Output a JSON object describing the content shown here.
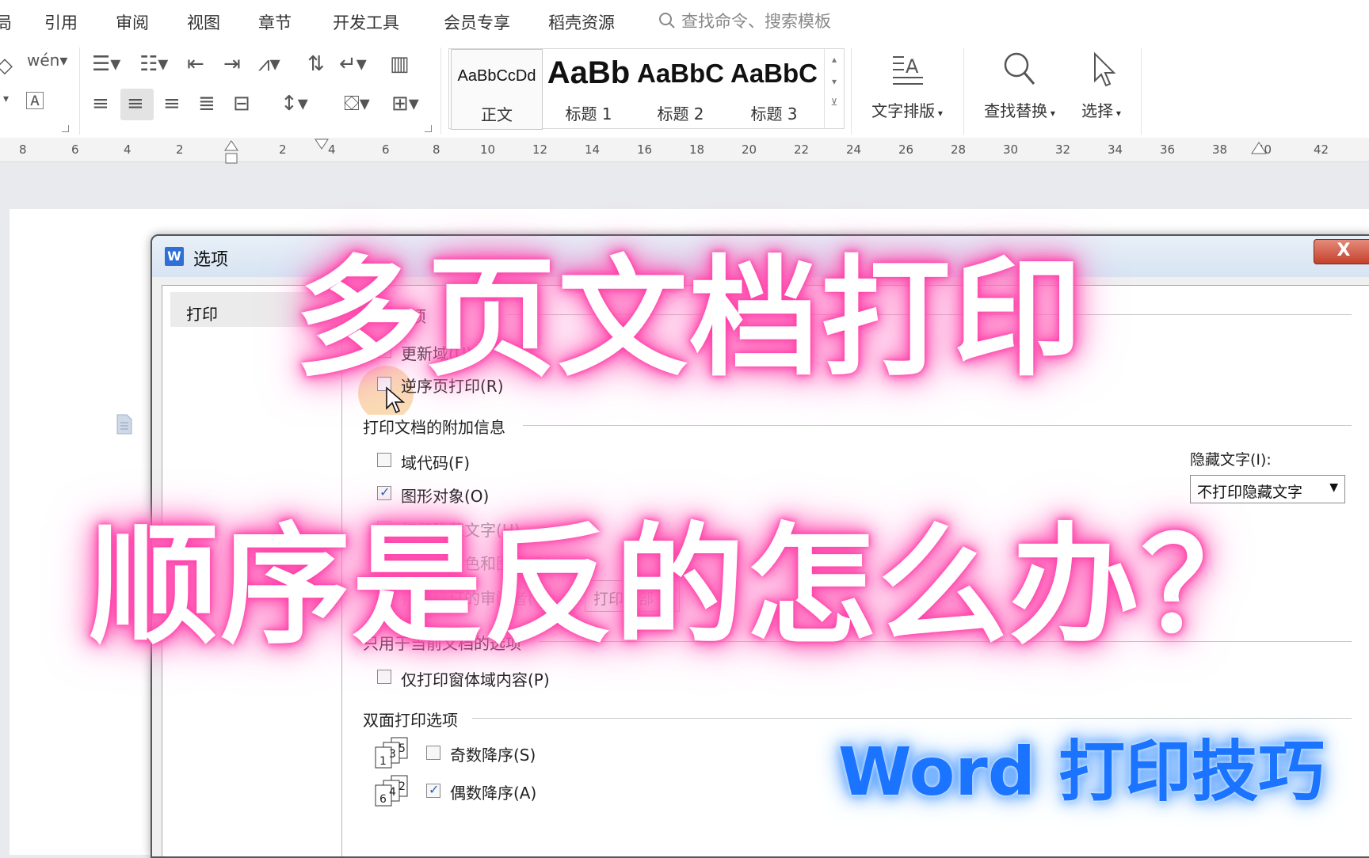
{
  "menu": {
    "items": [
      "局",
      "引用",
      "审阅",
      "视图",
      "章节",
      "开发工具",
      "会员专享",
      "稻壳资源"
    ],
    "search_placeholder": "查找命令、搜索模板"
  },
  "ribbon": {
    "pinyin_label": "wén",
    "styles": [
      {
        "sample": "AaBbCcDd",
        "label": "正文"
      },
      {
        "sample": "AaBb",
        "label": "标题 1"
      },
      {
        "sample": "AaBbC",
        "label": "标题 2"
      },
      {
        "sample": "AaBbC",
        "label": "标题 3"
      }
    ],
    "text_layout_label": "文字排版",
    "find_replace_label": "查找替换",
    "select_label": "选择"
  },
  "ruler": {
    "ticks": [
      "8",
      "6",
      "4",
      "2",
      "2",
      "4",
      "6",
      "8",
      "10",
      "12",
      "14",
      "16",
      "18",
      "20",
      "22",
      "24",
      "26",
      "28",
      "30",
      "32",
      "34",
      "36",
      "38",
      "40",
      "42"
    ]
  },
  "dialog": {
    "title": "选项",
    "close_label": "X",
    "nav": {
      "selected": "打印"
    },
    "print_options": {
      "group_label": "打印选项",
      "update_fields": "更新域(U)",
      "reverse_order": "逆序页打印(R)"
    },
    "additional_info": {
      "group_label": "打印文档的附加信息",
      "field_codes": "域代码(F)",
      "drawing_objects": "图形对象(O)",
      "hidden_text_row": "打印隐藏文字(H)",
      "background_row": "打印背景色和图像(B)",
      "markup_row": "打印修订的审阅者(T)",
      "markup_button": "打印全部",
      "hidden_text_label": "隐藏文字(I):",
      "hidden_text_select": "不打印隐藏文字"
    },
    "current_doc": {
      "group_label": "只用于当前文档的选项",
      "form_fields_only": "仅打印窗体域内容(P)"
    },
    "duplex": {
      "group_label": "双面打印选项",
      "odd_icon_numbers": [
        "1",
        "3",
        "5"
      ],
      "even_icon_numbers": [
        "6",
        "4",
        "2"
      ],
      "odd_descending": "奇数降序(S)",
      "even_descending": "偶数降序(A)"
    }
  },
  "overlay": {
    "line1": "多页文档打印",
    "line2": "顺序是反的怎么办？",
    "tag": "Word 打印技巧"
  }
}
